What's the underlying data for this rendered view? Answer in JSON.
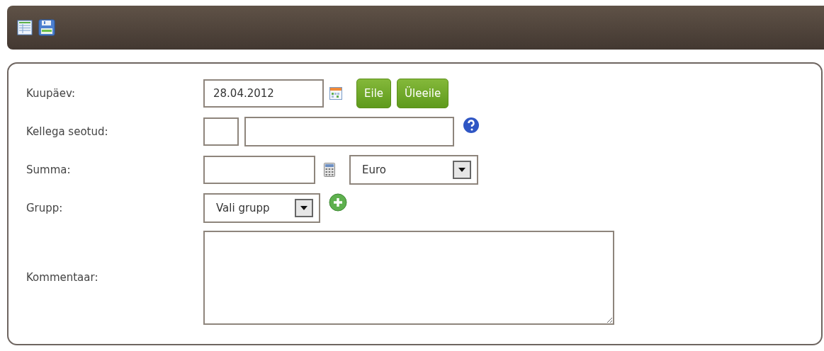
{
  "toolbar": {
    "items": [
      {
        "kind": "table"
      },
      {
        "kind": "save"
      }
    ]
  },
  "form": {
    "rows": [
      {
        "label": "Kuupäev:",
        "kind": "date",
        "value": "28.04.2012",
        "buttons": [
          "Eile",
          "Üleeile"
        ]
      },
      {
        "label": "Kellega seotud:",
        "kind": "contact"
      },
      {
        "label": "Summa:",
        "kind": "amount",
        "currency": "Euro"
      },
      {
        "label": "Grupp:",
        "kind": "group",
        "value": "Vali grupp"
      },
      {
        "label": "Kommentaar:",
        "kind": "comment"
      }
    ]
  }
}
